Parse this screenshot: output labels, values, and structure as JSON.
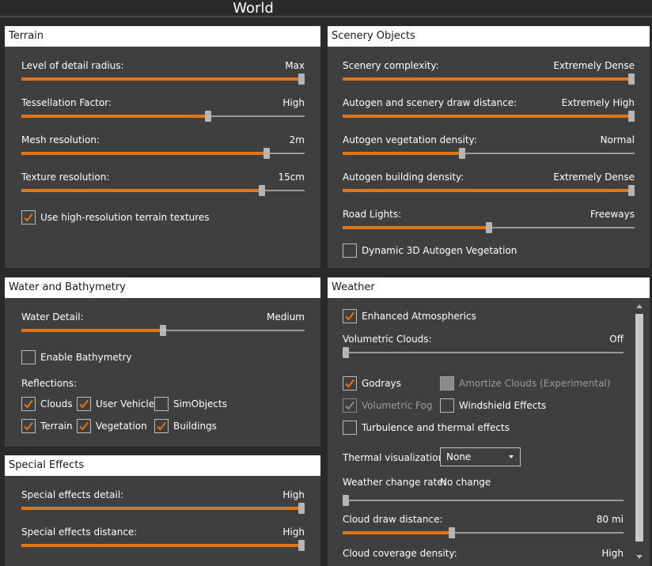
{
  "window": {
    "title": "World"
  },
  "terrain": {
    "header": "Terrain",
    "lod": {
      "label": "Level of detail radius:",
      "value": "Max",
      "level": 1.0
    },
    "tessellation": {
      "label": "Tessellation Factor:",
      "value": "High",
      "level": 0.66
    },
    "mesh": {
      "label": "Mesh resolution:",
      "value": "2m",
      "level": 0.866
    },
    "texture": {
      "label": "Texture resolution:",
      "value": "15cm",
      "level": 0.85
    },
    "hires": {
      "label": "Use high-resolution terrain textures",
      "checked": true
    }
  },
  "scenery": {
    "header": "Scenery Objects",
    "complexity": {
      "label": "Scenery complexity:",
      "value": "Extremely Dense",
      "level": 1.0
    },
    "autogen_distance": {
      "label": "Autogen and scenery draw distance:",
      "value": "Extremely High",
      "level": 1.0
    },
    "vegetation_density": {
      "label": "Autogen vegetation density:",
      "value": "Normal",
      "level": 0.41
    },
    "building_density": {
      "label": "Autogen building density:",
      "value": "Extremely Dense",
      "level": 1.0
    },
    "road_lights": {
      "label": "Road Lights:",
      "value": "Freeways",
      "level": 0.5
    },
    "dynamic_3d": {
      "label": "Dynamic 3D Autogen Vegetation",
      "checked": false
    }
  },
  "water": {
    "header": "Water and Bathymetry",
    "detail": {
      "label": "Water Detail:",
      "value": "Medium",
      "level": 0.5
    },
    "bathymetry": {
      "label": "Enable Bathymetry",
      "checked": false
    },
    "reflections_label": "Reflections:",
    "reflections": {
      "clouds": {
        "label": "Clouds",
        "checked": true
      },
      "user_vehicle": {
        "label": "User Vehicle",
        "checked": true
      },
      "simobjects": {
        "label": "SimObjects",
        "checked": false
      },
      "terrain": {
        "label": "Terrain",
        "checked": true
      },
      "vegetation": {
        "label": "Vegetation",
        "checked": true
      },
      "buildings": {
        "label": "Buildings",
        "checked": true
      }
    }
  },
  "effects": {
    "header": "Special Effects",
    "detail": {
      "label": "Special effects detail:",
      "value": "High",
      "level": 1.0
    },
    "distance": {
      "label": "Special effects distance:",
      "value": "High",
      "level": 1.0
    }
  },
  "weather": {
    "header": "Weather",
    "enhanced": {
      "label": "Enhanced Atmospherics",
      "checked": true
    },
    "volumetric_clouds": {
      "label": "Volumetric Clouds:",
      "value": "Off",
      "level": 0.0
    },
    "godrays": {
      "label": "Godrays",
      "checked": true
    },
    "amortize": {
      "label": "Amortize Clouds (Experimental)",
      "checked": false,
      "disabled": true
    },
    "volumetric_fog": {
      "label": "Volumetric Fog",
      "checked": true,
      "disabled": true
    },
    "windshield": {
      "label": "Windshield Effects",
      "checked": false
    },
    "turbulence": {
      "label": "Turbulence and thermal effects",
      "checked": false
    },
    "thermal": {
      "label": "Thermal visualization:",
      "selected": "None"
    },
    "change_rate": {
      "label": "Weather change rate:",
      "value": "No change",
      "level": 0.0
    },
    "cloud_distance": {
      "label": "Cloud draw distance:",
      "value": "80 mi",
      "level": 0.39
    },
    "cloud_coverage": {
      "label": "Cloud coverage density:",
      "value": "High"
    }
  },
  "colors": {
    "accent": "#e27616",
    "panel": "#3f3f3f",
    "background": "#2a2a2a",
    "header": "#ffffff"
  }
}
